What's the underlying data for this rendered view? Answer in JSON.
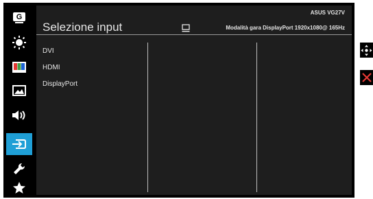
{
  "window": {
    "title": "Selezione input",
    "model": "ASUS  VG27V",
    "mode_line": "Modalità  gara  DisplayPort  1920x1080@  165Hz"
  },
  "sidebar": {
    "items": [
      {
        "icon": "gameplus-icon",
        "label": "G",
        "active": false
      },
      {
        "icon": "brightness-icon",
        "active": false
      },
      {
        "icon": "color-icon",
        "active": false
      },
      {
        "icon": "image-icon",
        "active": false
      },
      {
        "icon": "sound-icon",
        "active": false
      },
      {
        "icon": "input-icon",
        "active": true
      },
      {
        "icon": "settings-wrench-icon",
        "active": false
      },
      {
        "icon": "favorite-star-icon",
        "active": false
      }
    ]
  },
  "input_list": {
    "items": [
      "DVI",
      "HDMI",
      "DisplayPort"
    ]
  },
  "nav": [
    {
      "icon": "move-icon"
    },
    {
      "icon": "close-icon"
    }
  ],
  "colors": {
    "accent": "#1f9fd6",
    "close": "#e53935",
    "panel": "#1e1e1e"
  }
}
